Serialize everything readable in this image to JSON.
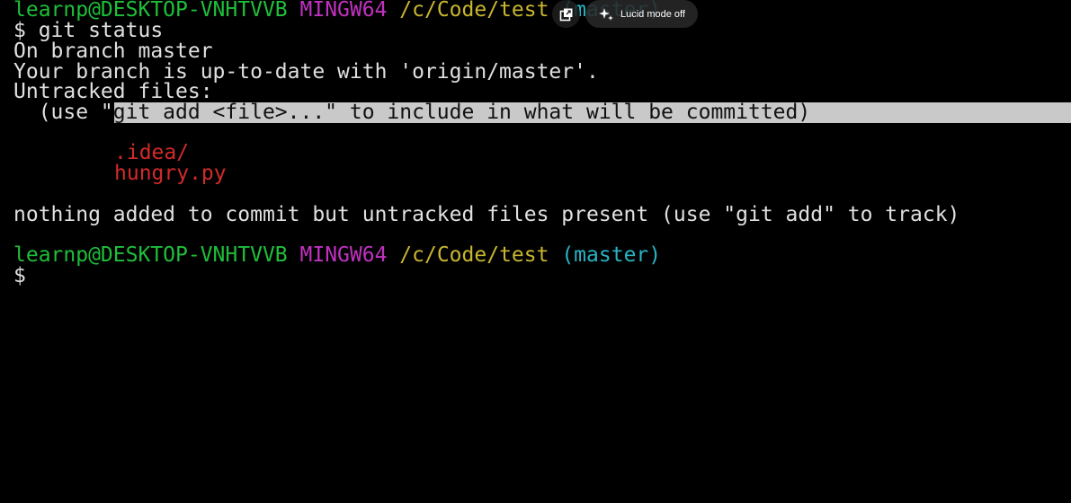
{
  "prompt1": {
    "user_host": "learnp@DESKTOP-VNHTVVB",
    "system": "MINGW64",
    "path": "/c/Code/test",
    "branch": "(master)"
  },
  "command": "$ git status",
  "output": {
    "on_branch": "On branch master",
    "up_to_date": "Your branch is up-to-date with 'origin/master'.",
    "untracked_header": "Untracked files:",
    "hint_prefix": "  (use \"",
    "hint_selected": "git add <file>...\" to include in what will be committed)",
    "untracked_files": [
      ".idea/",
      "hungry.py"
    ],
    "nothing_added": "nothing added to commit but untracked files present (use \"git add\" to track)"
  },
  "prompt2": {
    "user_host": "learnp@DESKTOP-VNHTVVB",
    "system": "MINGW64",
    "path": "/c/Code/test",
    "branch": "(master)",
    "cursor": "$"
  },
  "overlay": {
    "popout_icon": "popout-icon",
    "sparkle_icon": "sparkle-icon",
    "lucid_label": "Lucid mode off"
  },
  "colors": {
    "background": "#000000",
    "user_host": "#1fbf3a",
    "system": "#c131c1",
    "path": "#c9b630",
    "branch": "#29b3c4",
    "untracked": "#d22a2a",
    "selection": "#c9c9c9"
  }
}
